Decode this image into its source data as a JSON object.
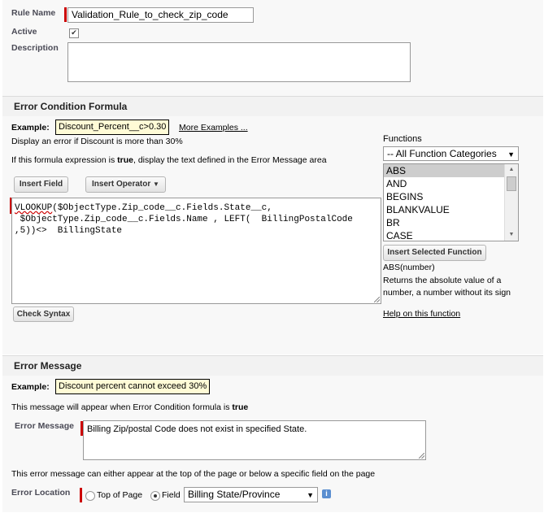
{
  "rule": {
    "name_label": "Rule Name",
    "name_value": "Validation_Rule_to_check_zip_code",
    "active_label": "Active",
    "active_checked": true,
    "description_label": "Description",
    "description_value": ""
  },
  "formula_section": {
    "title": "Error Condition Formula",
    "example_label": "Example:",
    "example_value": "Discount_Percent__c>0.30",
    "more_examples": "More Examples ...",
    "hint1": "Display an error if Discount is more than 30%",
    "hint2_prefix": "If this formula expression is ",
    "hint2_bold": "true",
    "hint2_suffix": ", display the text defined in the Error Message area",
    "insert_field": "Insert Field",
    "insert_operator": "Insert Operator",
    "formula_line1_err": "VLOOKUP",
    "formula_line1_rest": "($ObjectType.Zip_code__c.Fields.State__c,",
    "formula_line2": " $ObjectType.Zip_code__c.Fields.Name , LEFT(  BillingPostalCode",
    "formula_line3": ",5))<>  BillingState",
    "check_syntax": "Check Syntax",
    "functions_label": "Functions",
    "function_category": "-- All Function Categories",
    "functions": [
      "ABS",
      "AND",
      "BEGINS",
      "BLANKVALUE",
      "BR",
      "CASE"
    ],
    "selected_function": "ABS",
    "insert_selected": "Insert Selected Function",
    "signature": "ABS(number)",
    "description": "Returns the absolute value of a number, a number without its sign",
    "help_link": "Help on this function"
  },
  "error_section": {
    "title": "Error Message",
    "example_label": "Example:",
    "example_value": "Discount percent cannot exceed 30%",
    "info_prefix": "This message will appear when Error Condition formula is ",
    "info_bold": "true",
    "message_label": "Error Message",
    "message_value": "Billing Zip/postal Code does not exist in specified State.",
    "location_info": "This error message can either appear at the top of the page or below a specific field on the page",
    "location_label": "Error Location",
    "top_of_page": "Top of Page",
    "field_option": "Field",
    "selected_location": "field",
    "field_value": "Billing State/Province",
    "info_icon": "i"
  },
  "colors": {
    "required": "#cc0000",
    "example_bg": "#fffbd6",
    "selected_row": "#cdcdcd"
  }
}
